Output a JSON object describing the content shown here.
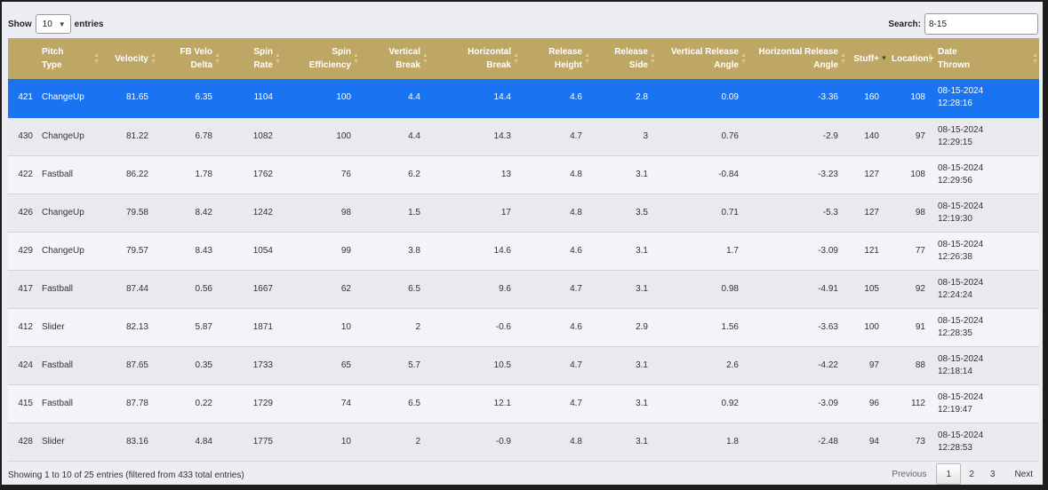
{
  "controls": {
    "show_label": "Show",
    "page_size": "10",
    "entries_label": "entries",
    "search_label": "Search:",
    "search_value": "8-15"
  },
  "columns": [
    {
      "l1": "",
      "l2": "",
      "sortable": false
    },
    {
      "l1": "Pitch",
      "l2": "Type",
      "sortable": true
    },
    {
      "l1": "Velocity",
      "l2": "",
      "sortable": true
    },
    {
      "l1": "FB Velo",
      "l2": "Delta",
      "sortable": true
    },
    {
      "l1": "Spin",
      "l2": "Rate",
      "sortable": true
    },
    {
      "l1": "Spin",
      "l2": "Efficiency",
      "sortable": true
    },
    {
      "l1": "Vertical",
      "l2": "Break",
      "sortable": true
    },
    {
      "l1": "Horizontal",
      "l2": "Break",
      "sortable": true
    },
    {
      "l1": "Release",
      "l2": "Height",
      "sortable": true
    },
    {
      "l1": "Release",
      "l2": "Side",
      "sortable": true
    },
    {
      "l1": "Vertical Release",
      "l2": "Angle",
      "sortable": true
    },
    {
      "l1": "Horizontal Release",
      "l2": "Angle",
      "sortable": true
    },
    {
      "l1": "Stuff+",
      "l2": "",
      "sortable": true,
      "sorted": "desc"
    },
    {
      "l1": "Location+",
      "l2": "",
      "sortable": true
    },
    {
      "l1": "Date",
      "l2": "Thrown",
      "sortable": true
    }
  ],
  "rows": [
    {
      "id": "421",
      "pitch_type": "ChangeUp",
      "velocity": "81.65",
      "fb_velo_delta": "6.35",
      "spin_rate": "1104",
      "spin_efficiency": "100",
      "vertical_break": "4.4",
      "horizontal_break": "14.4",
      "release_height": "4.6",
      "release_side": "2.8",
      "vertical_release_angle": "0.09",
      "horizontal_release_angle": "-3.36",
      "stuff_plus": "160",
      "location_plus": "108",
      "date": "08-15-2024",
      "time": "12:28:16"
    },
    {
      "id": "430",
      "pitch_type": "ChangeUp",
      "velocity": "81.22",
      "fb_velo_delta": "6.78",
      "spin_rate": "1082",
      "spin_efficiency": "100",
      "vertical_break": "4.4",
      "horizontal_break": "14.3",
      "release_height": "4.7",
      "release_side": "3",
      "vertical_release_angle": "0.76",
      "horizontal_release_angle": "-2.9",
      "stuff_plus": "140",
      "location_plus": "97",
      "date": "08-15-2024",
      "time": "12:29:15"
    },
    {
      "id": "422",
      "pitch_type": "Fastball",
      "velocity": "86.22",
      "fb_velo_delta": "1.78",
      "spin_rate": "1762",
      "spin_efficiency": "76",
      "vertical_break": "6.2",
      "horizontal_break": "13",
      "release_height": "4.8",
      "release_side": "3.1",
      "vertical_release_angle": "-0.84",
      "horizontal_release_angle": "-3.23",
      "stuff_plus": "127",
      "location_plus": "108",
      "date": "08-15-2024",
      "time": "12:29:56"
    },
    {
      "id": "426",
      "pitch_type": "ChangeUp",
      "velocity": "79.58",
      "fb_velo_delta": "8.42",
      "spin_rate": "1242",
      "spin_efficiency": "98",
      "vertical_break": "1.5",
      "horizontal_break": "17",
      "release_height": "4.8",
      "release_side": "3.5",
      "vertical_release_angle": "0.71",
      "horizontal_release_angle": "-5.3",
      "stuff_plus": "127",
      "location_plus": "98",
      "date": "08-15-2024",
      "time": "12:19:30"
    },
    {
      "id": "429",
      "pitch_type": "ChangeUp",
      "velocity": "79.57",
      "fb_velo_delta": "8.43",
      "spin_rate": "1054",
      "spin_efficiency": "99",
      "vertical_break": "3.8",
      "horizontal_break": "14.6",
      "release_height": "4.6",
      "release_side": "3.1",
      "vertical_release_angle": "1.7",
      "horizontal_release_angle": "-3.09",
      "stuff_plus": "121",
      "location_plus": "77",
      "date": "08-15-2024",
      "time": "12:26:38"
    },
    {
      "id": "417",
      "pitch_type": "Fastball",
      "velocity": "87.44",
      "fb_velo_delta": "0.56",
      "spin_rate": "1667",
      "spin_efficiency": "62",
      "vertical_break": "6.5",
      "horizontal_break": "9.6",
      "release_height": "4.7",
      "release_side": "3.1",
      "vertical_release_angle": "0.98",
      "horizontal_release_angle": "-4.91",
      "stuff_plus": "105",
      "location_plus": "92",
      "date": "08-15-2024",
      "time": "12:24:24"
    },
    {
      "id": "412",
      "pitch_type": "Slider",
      "velocity": "82.13",
      "fb_velo_delta": "5.87",
      "spin_rate": "1871",
      "spin_efficiency": "10",
      "vertical_break": "2",
      "horizontal_break": "-0.6",
      "release_height": "4.6",
      "release_side": "2.9",
      "vertical_release_angle": "1.56",
      "horizontal_release_angle": "-3.63",
      "stuff_plus": "100",
      "location_plus": "91",
      "date": "08-15-2024",
      "time": "12:28:35"
    },
    {
      "id": "424",
      "pitch_type": "Fastball",
      "velocity": "87.65",
      "fb_velo_delta": "0.35",
      "spin_rate": "1733",
      "spin_efficiency": "65",
      "vertical_break": "5.7",
      "horizontal_break": "10.5",
      "release_height": "4.7",
      "release_side": "3.1",
      "vertical_release_angle": "2.6",
      "horizontal_release_angle": "-4.22",
      "stuff_plus": "97",
      "location_plus": "88",
      "date": "08-15-2024",
      "time": "12:18:14"
    },
    {
      "id": "415",
      "pitch_type": "Fastball",
      "velocity": "87.78",
      "fb_velo_delta": "0.22",
      "spin_rate": "1729",
      "spin_efficiency": "74",
      "vertical_break": "6.5",
      "horizontal_break": "12.1",
      "release_height": "4.7",
      "release_side": "3.1",
      "vertical_release_angle": "0.92",
      "horizontal_release_angle": "-3.09",
      "stuff_plus": "96",
      "location_plus": "112",
      "date": "08-15-2024",
      "time": "12:19:47"
    },
    {
      "id": "428",
      "pitch_type": "Slider",
      "velocity": "83.16",
      "fb_velo_delta": "4.84",
      "spin_rate": "1775",
      "spin_efficiency": "10",
      "vertical_break": "2",
      "horizontal_break": "-0.9",
      "release_height": "4.8",
      "release_side": "3.1",
      "vertical_release_angle": "1.8",
      "horizontal_release_angle": "-2.48",
      "stuff_plus": "94",
      "location_plus": "73",
      "date": "08-15-2024",
      "time": "12:28:53"
    }
  ],
  "selected_row": 0,
  "footer": {
    "info": "Showing 1 to 10 of 25 entries (filtered from 433 total entries)"
  },
  "pagination": {
    "previous": "Previous",
    "pages": [
      "1",
      "2",
      "3"
    ],
    "current_page": "1",
    "next": "Next"
  },
  "colors": {
    "header_bg": "#bea765",
    "selected_row": "#1a73f0",
    "page_bg": "#eceef4"
  }
}
